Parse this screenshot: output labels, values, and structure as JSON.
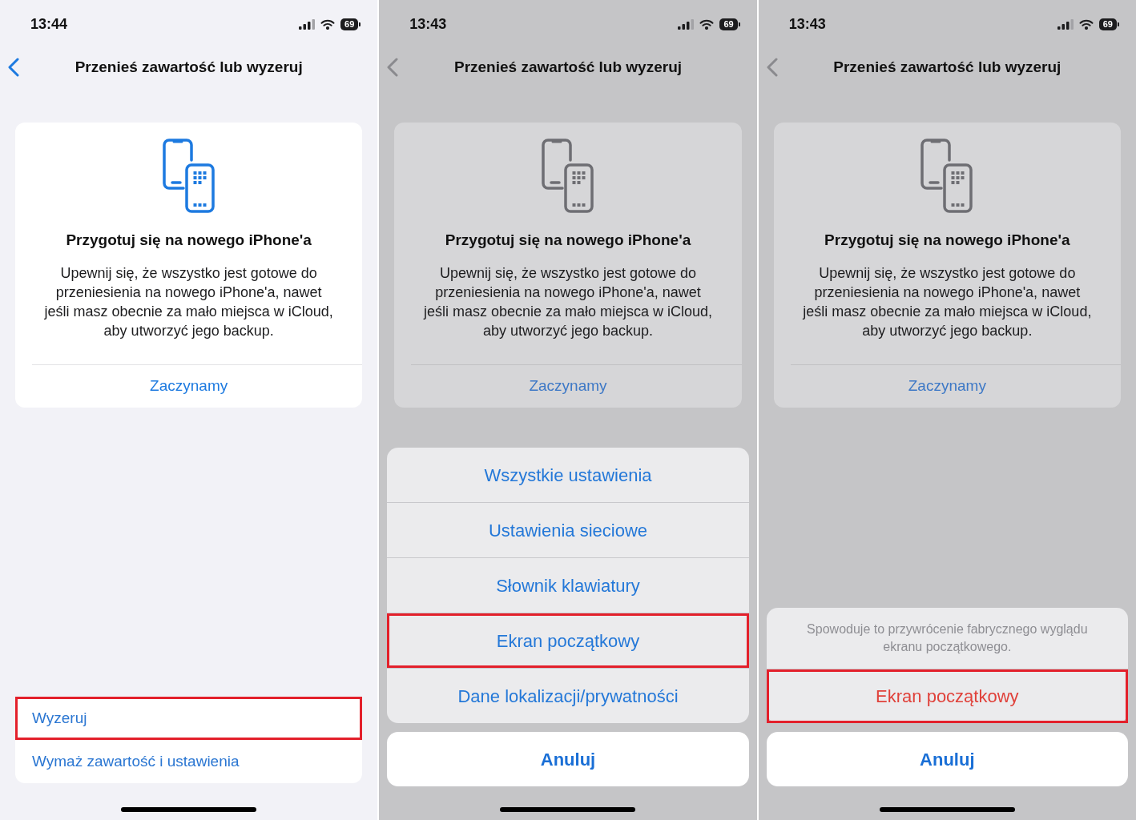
{
  "screens": [
    {
      "dimmed": false,
      "status_bar": {
        "time": "13:44",
        "battery": "69"
      },
      "nav": {
        "title": "Przenieś zawartość lub wyzeruj"
      },
      "card": {
        "title": "Przygotuj się na nowego iPhone'a",
        "body": "Upewnij się, że wszystko jest gotowe do przeniesienia na nowego iPhone'a, nawet jeśli masz obecnie za mało miejsca w iCloud, aby utworzyć jego backup.",
        "link": "Zaczynamy"
      },
      "list": [
        {
          "label": "Wyzeruj",
          "highlighted": true
        },
        {
          "label": "Wymaż zawartość i ustawienia",
          "highlighted": false
        }
      ]
    },
    {
      "dimmed": true,
      "status_bar": {
        "time": "13:43",
        "battery": "69"
      },
      "nav": {
        "title": "Przenieś zawartość lub wyzeruj"
      },
      "card": {
        "title": "Przygotuj się na nowego iPhone'a",
        "body": "Upewnij się, że wszystko jest gotowe do przeniesienia na nowego iPhone'a, nawet jeśli masz obecnie za mało miejsca w iCloud, aby utworzyć jego backup.",
        "link": "Zaczynamy"
      },
      "action_sheet": {
        "actions": [
          {
            "kind": "default",
            "label": "Wszystkie ustawienia",
            "highlighted": false
          },
          {
            "kind": "default",
            "label": "Ustawienia sieciowe",
            "highlighted": false
          },
          {
            "kind": "default",
            "label": "Słownik klawiatury",
            "highlighted": false
          },
          {
            "kind": "default",
            "label": "Ekran początkowy",
            "highlighted": true
          },
          {
            "kind": "default",
            "label": "Dane lokalizacji/prywatności",
            "highlighted": false
          }
        ],
        "cancel": "Anuluj"
      }
    },
    {
      "dimmed": true,
      "status_bar": {
        "time": "13:43",
        "battery": "69"
      },
      "nav": {
        "title": "Przenieś zawartość lub wyzeruj"
      },
      "card": {
        "title": "Przygotuj się na nowego iPhone'a",
        "body": "Upewnij się, że wszystko jest gotowe do przeniesienia na nowego iPhone'a, nawet jeśli masz obecnie za mało miejsca w iCloud, aby utworzyć jego backup.",
        "link": "Zaczynamy"
      },
      "action_sheet": {
        "message": "Spowoduje to przywrócenie fabrycznego wyglądu ekranu początkowego.",
        "actions": [
          {
            "kind": "destructive",
            "label": "Ekran początkowy",
            "highlighted": true
          }
        ],
        "cancel": "Anuluj"
      }
    }
  ]
}
